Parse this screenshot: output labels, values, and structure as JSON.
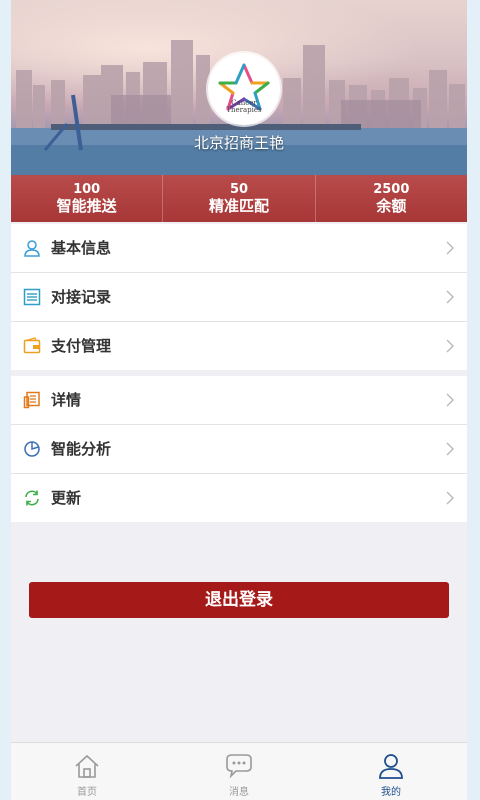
{
  "profile": {
    "username": "北京招商王艳",
    "avatar_logo_line1": "Cancer",
    "avatar_logo_line2": "Therapies"
  },
  "stats": [
    {
      "value": "100",
      "label": "智能推送"
    },
    {
      "value": "50",
      "label": "精准匹配"
    },
    {
      "value": "2500",
      "label": "余额"
    }
  ],
  "menu_group_1": [
    {
      "label": "基本信息",
      "icon": "user-icon"
    },
    {
      "label": "对接记录",
      "icon": "list-icon"
    },
    {
      "label": "支付管理",
      "icon": "wallet-icon"
    }
  ],
  "menu_group_2": [
    {
      "label": "详情",
      "icon": "document-icon"
    },
    {
      "label": "智能分析",
      "icon": "pie-chart-icon"
    },
    {
      "label": "更新",
      "icon": "refresh-icon"
    }
  ],
  "logout_label": "退出登录",
  "tabbar": [
    {
      "label": "首页",
      "icon": "home-icon",
      "active": false
    },
    {
      "label": "消息",
      "icon": "message-icon",
      "active": false
    },
    {
      "label": "我的",
      "icon": "person-icon",
      "active": true
    }
  ],
  "colors": {
    "accent_red": "#a51a18",
    "stats_red": "#b04242",
    "active_tab": "#1f4e8c",
    "user_icon": "#3aa0d8",
    "list_icon": "#2f9ec5",
    "wallet_icon": "#f0a020",
    "document_icon": "#e27a1c",
    "pie_icon": "#3b6fb5",
    "refresh_icon": "#3cae4a"
  }
}
